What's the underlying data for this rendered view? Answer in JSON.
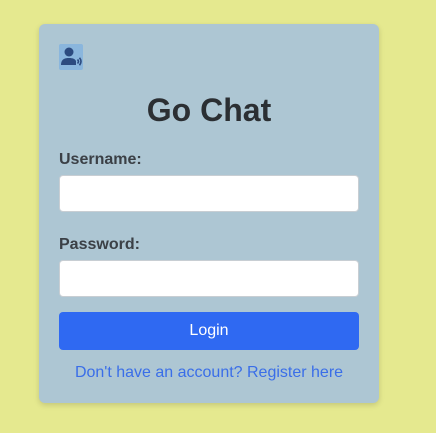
{
  "colors": {
    "page_background": "#e5e98f",
    "card_background": "#adc6d3",
    "button_background": "#2f69f2",
    "link_color": "#3a6ee8"
  },
  "logo": {
    "icon": "user-chat-icon"
  },
  "title": "Go Chat",
  "form": {
    "username_label": "Username:",
    "username_value": "",
    "password_label": "Password:",
    "password_value": "",
    "login_label": "Login"
  },
  "register_link": "Don't have an account? Register here"
}
